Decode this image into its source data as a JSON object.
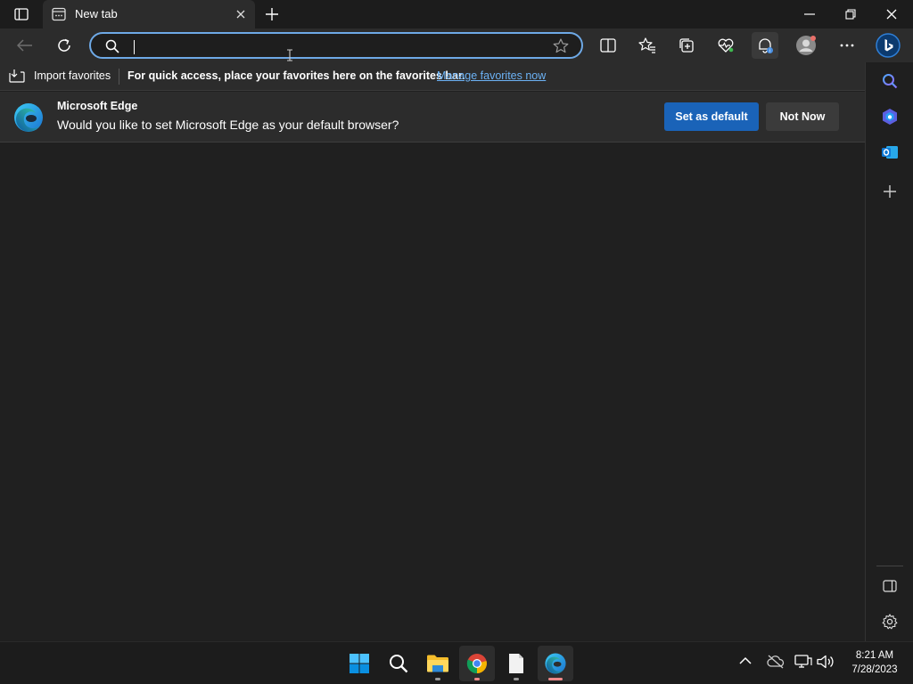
{
  "window": {
    "tab_title": "New tab"
  },
  "address_bar": {
    "value": "",
    "placeholder": ""
  },
  "favorites_bar": {
    "import_label": "Import favorites",
    "hint": "For quick access, place your favorites here on the favorites bar.",
    "manage_link": "Manage favorites now"
  },
  "infobar": {
    "title": "Microsoft Edge",
    "message": "Would you like to set Microsoft Edge as your default browser?",
    "primary_button": "Set as default",
    "secondary_button": "Not Now"
  },
  "toolbar_icons": [
    "back-icon",
    "refresh-icon",
    "split-screen-icon",
    "favorites-icon",
    "collections-icon",
    "performance-icon",
    "notifications-icon",
    "profile-icon",
    "more-icon",
    "bing-chat-icon"
  ],
  "sidebar_icons": [
    "search-icon",
    "copilot-icon",
    "outlook-icon",
    "add-icon",
    "hide-sidebar-icon",
    "settings-icon"
  ],
  "taskbar": {
    "apps": [
      "start-icon",
      "search-icon",
      "file-explorer-icon",
      "chrome-icon",
      "notepad-icon",
      "edge-icon"
    ],
    "time": "8:21 AM",
    "date": "7/28/2023"
  },
  "colors": {
    "accent": "#1a63b8",
    "link": "#6cb2f5",
    "address_focus": "#6ea9e6"
  }
}
